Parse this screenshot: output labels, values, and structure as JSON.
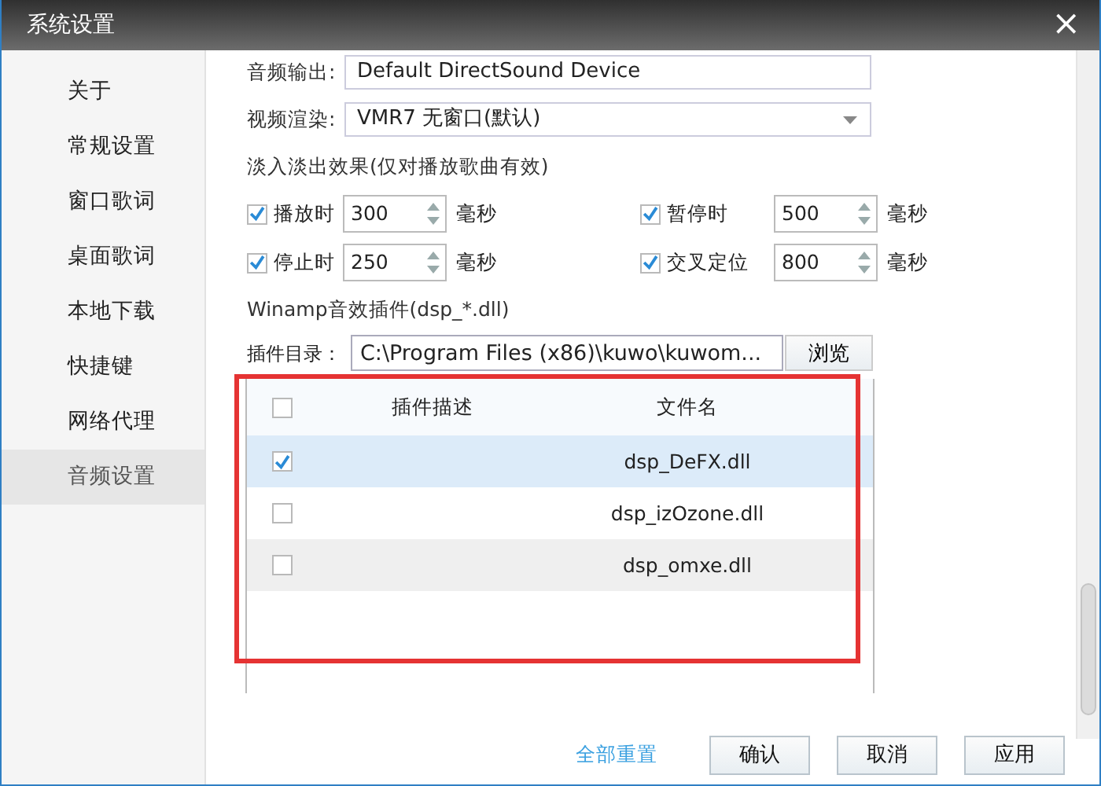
{
  "window": {
    "title": "系统设置",
    "close": "×"
  },
  "sidebar": {
    "items": [
      {
        "label": "关于",
        "selected": false
      },
      {
        "label": "常规设置",
        "selected": false
      },
      {
        "label": "窗口歌词",
        "selected": false
      },
      {
        "label": "桌面歌词",
        "selected": false
      },
      {
        "label": "本地下载",
        "selected": false
      },
      {
        "label": "快捷键",
        "selected": false
      },
      {
        "label": "网络代理",
        "selected": false
      },
      {
        "label": "音频设置",
        "selected": true
      }
    ]
  },
  "audio_output": {
    "label": "音频输出:",
    "value": "Default DirectSound Device"
  },
  "video_render": {
    "label": "视频渲染:",
    "value": "VMR7 无窗口(默认)"
  },
  "fade": {
    "heading": "淡入淡出效果(仅对播放歌曲有效)",
    "items": [
      {
        "label": "播放时",
        "checked": true,
        "value": "300",
        "unit": "毫秒"
      },
      {
        "label": "暂停时",
        "checked": true,
        "value": "500",
        "unit": "毫秒"
      },
      {
        "label": "停止时",
        "checked": true,
        "value": "250",
        "unit": "毫秒"
      },
      {
        "label": "交叉定位",
        "checked": true,
        "value": "800",
        "unit": "毫秒"
      }
    ]
  },
  "plugins": {
    "heading": "Winamp音效插件(dsp_*.dll)",
    "dir_label": "插件目录：",
    "dir_value": "C:\\Program  Files  (x86)\\kuwo\\kuwom...",
    "browse_button": "浏览",
    "list": {
      "highlighted": true,
      "header_checked": false,
      "columns": [
        "插件描述",
        "文件名"
      ],
      "rows": [
        {
          "file": "dsp_DeFX.dll",
          "checked": true,
          "selected": true,
          "hovered": false
        },
        {
          "file": "dsp_izOzone.dll",
          "checked": false,
          "selected": false,
          "hovered": false
        },
        {
          "file": "dsp_omxe.dll",
          "checked": false,
          "selected": false,
          "hovered": true
        }
      ]
    }
  },
  "footer": {
    "reset_link": "全部重置",
    "buttons": [
      "确认",
      "取消",
      "应用"
    ]
  }
}
